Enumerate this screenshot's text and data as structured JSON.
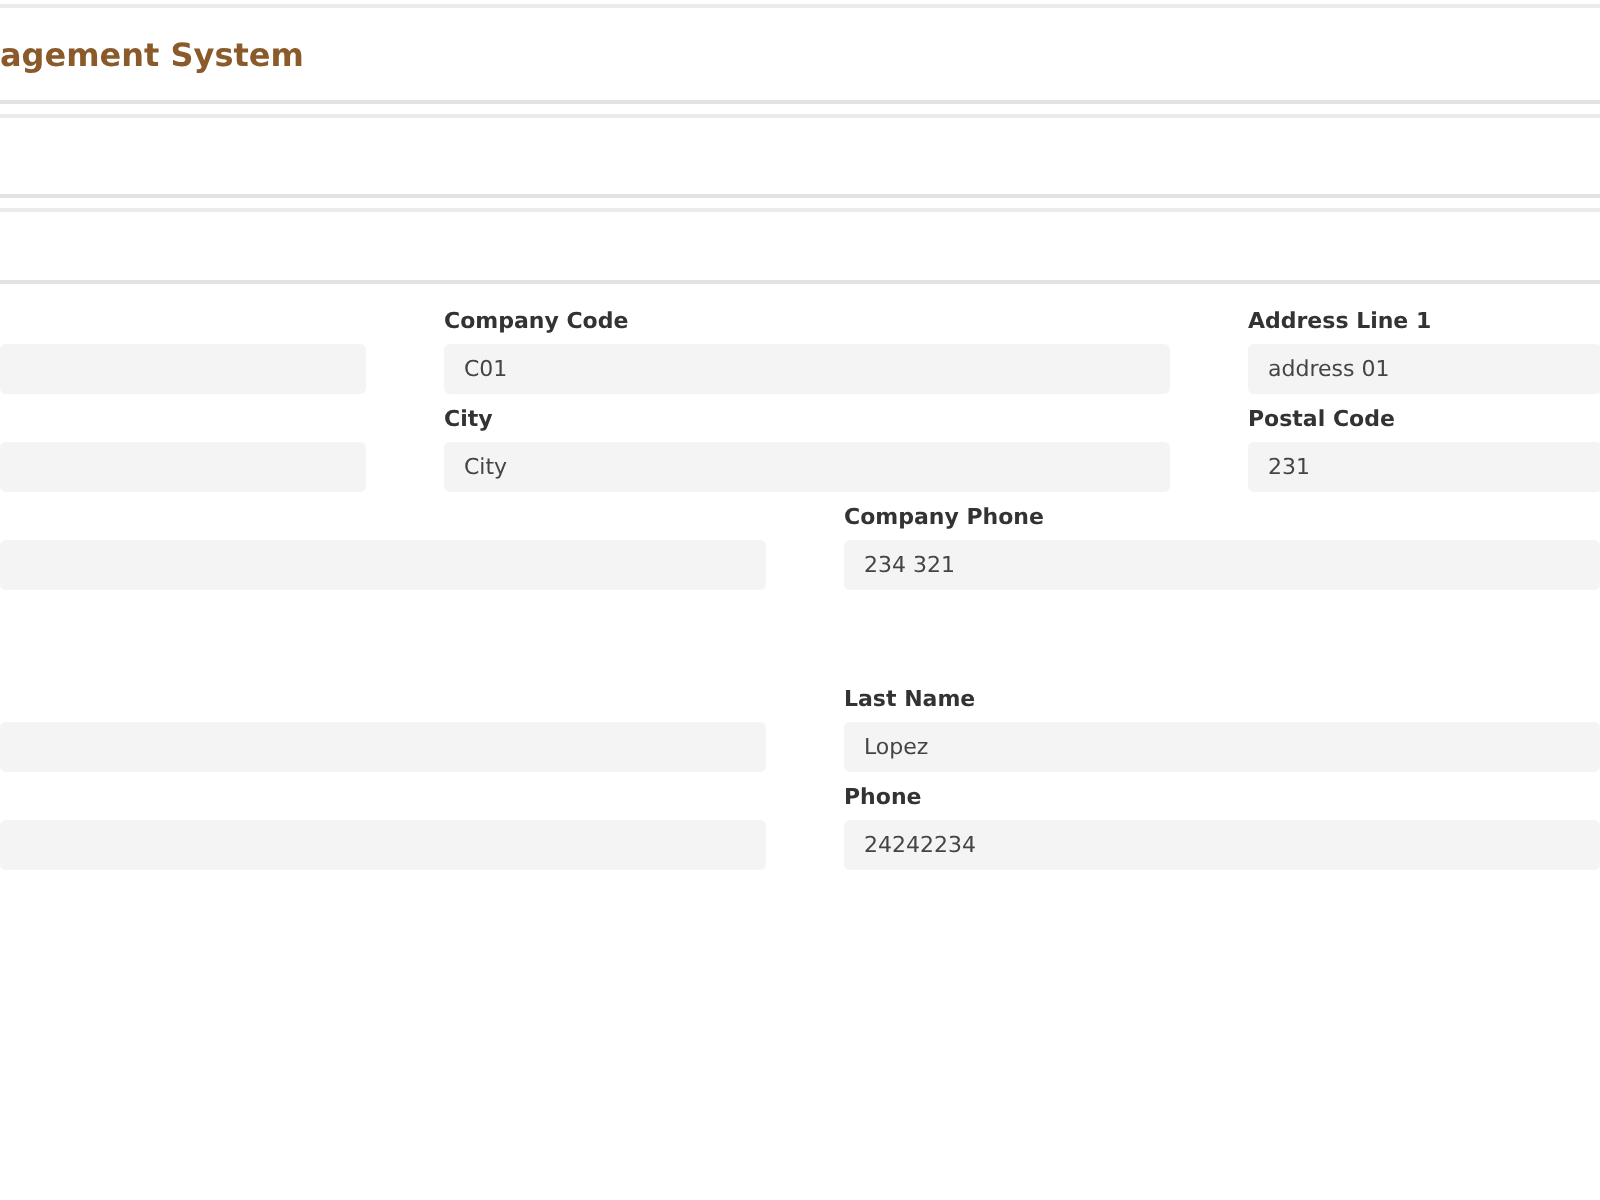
{
  "header": {
    "title": "agement System"
  },
  "rows": [
    {
      "fields": [
        {
          "kind": "cut"
        },
        {
          "kind": "full",
          "label": "Company Code",
          "value": "C01"
        },
        {
          "kind": "full",
          "label": "Address Line 1",
          "value": "address 01"
        }
      ]
    },
    {
      "fields": [
        {
          "kind": "cut"
        },
        {
          "kind": "full",
          "label": "City",
          "value": "City"
        },
        {
          "kind": "full",
          "label": "Postal Code",
          "value": "231"
        }
      ]
    },
    {
      "fields": [
        {
          "kind": "cut"
        },
        {
          "kind": "full",
          "label": "Company Phone",
          "value": "234 321"
        }
      ]
    },
    {
      "fields": [
        {
          "kind": "cut"
        },
        {
          "kind": "full",
          "label": "Last Name",
          "value": "Lopez"
        }
      ]
    },
    {
      "fields": [
        {
          "kind": "cut"
        },
        {
          "kind": "full",
          "label": "Phone",
          "value": "24242234"
        }
      ]
    }
  ]
}
